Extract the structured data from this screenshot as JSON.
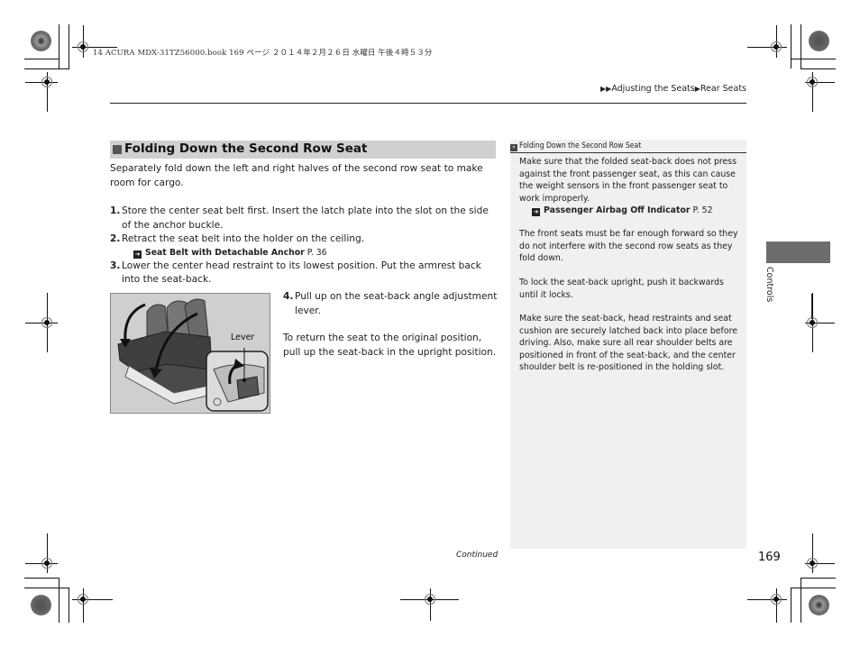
{
  "header": {
    "file_meta": "14 ACURA MDX-31TZ56000.book  169 ページ  ２０１４年２月２６日  水曜日  午後４時５３分",
    "breadcrumb": {
      "prefix_icon": "double-triangle-right-icon",
      "items": [
        "Adjusting the Seats",
        "Rear Seats"
      ],
      "separator_icon": "triangle-right-icon"
    }
  },
  "section": {
    "icon": "gray-square-bullet-icon",
    "title": "Folding Down the Second Row Seat",
    "intro": "Separately fold down the left and right halves of the second row seat to make room for cargo.",
    "steps": [
      {
        "num": "1.",
        "text": "Store the center seat belt first. Insert the latch plate into the slot on the side of the anchor buckle."
      },
      {
        "num": "2.",
        "text": "Retract the seat belt into the holder on the ceiling.",
        "ref": {
          "icon": "reference-arrow-icon",
          "title": "Seat Belt with Detachable Anchor",
          "page": "P. 36"
        }
      },
      {
        "num": "3.",
        "text": "Lower the center head restraint to its lowest position. Put the armrest back into the seat-back."
      },
      {
        "num": "4.",
        "text": "Pull up on the seat-back angle adjustment lever."
      }
    ],
    "return_text": "To return the seat to the original position, pull up the seat-back in the upright position.",
    "figure": {
      "callout_label": "Lever",
      "description": "Second row seat folding down illustration with lever inset"
    }
  },
  "sidebar": {
    "head_icon": "double-arrow-box-icon",
    "head": "Folding Down the Second Row Seat",
    "paragraphs": [
      {
        "text": "Make sure that the folded seat-back does not press against the front passenger seat, as this can cause the weight sensors in the front passenger seat to work improperly.",
        "ref": {
          "icon": "reference-arrow-icon",
          "title": "Passenger Airbag Off Indicator",
          "page": "P. 52"
        }
      },
      {
        "text": "The front seats must be far enough forward so they do not interfere with the second row seats as they fold down."
      },
      {
        "text": "To lock the seat-back upright, push it backwards until it locks."
      },
      {
        "text": "Make sure the seat-back, head restraints and seat cushion are securely latched back into place before driving. Also, make sure all rear shoulder belts are positioned in front of the seat-back, and the center shoulder belt is re-positioned in the holding slot."
      }
    ]
  },
  "chapter_tab": {
    "label": "Controls",
    "color": "#6d6d6d"
  },
  "footer": {
    "continued": "Continued",
    "page_number": "169"
  },
  "colors": {
    "section_head_bg": "#d0d0d0",
    "sidebar_bg": "#f0f0f0",
    "text": "#222222"
  }
}
